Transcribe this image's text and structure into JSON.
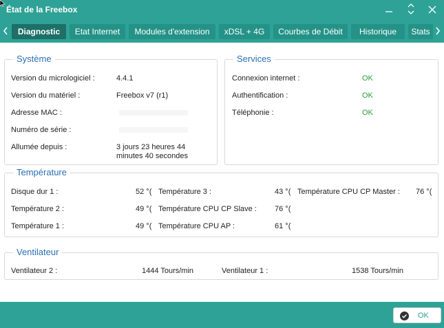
{
  "window": {
    "title": "État de la Freebox"
  },
  "tabs": [
    {
      "label": "Diagnostic"
    },
    {
      "label": "Etat Internet"
    },
    {
      "label": "Modules d'extension"
    },
    {
      "label": "xDSL + 4G"
    },
    {
      "label": "Courbes de Débit"
    },
    {
      "label": "Historique"
    },
    {
      "label": "Stats"
    }
  ],
  "systeme": {
    "legend": "Système",
    "rows": [
      {
        "label": "Version du micrologiciel :",
        "value": "4.4.1"
      },
      {
        "label": "Version du matériel :",
        "value": "Freebox v7 (r1)"
      },
      {
        "label": "Adresse MAC :",
        "value": ""
      },
      {
        "label": "Numéro de série :",
        "value": ""
      },
      {
        "label": "Allumée depuis :",
        "value_line1": "3 jours 23 heures 44",
        "value_line2": "minutes 40 secondes"
      }
    ]
  },
  "services": {
    "legend": "Services",
    "rows": [
      {
        "label": "Connexion internet :",
        "value": "OK"
      },
      {
        "label": "Authentification :",
        "value": "OK"
      },
      {
        "label": "Téléphonie :",
        "value": "OK"
      }
    ]
  },
  "temperature": {
    "legend": "Température",
    "rows": [
      {
        "l1": "Disque dur 1 :",
        "v1": "52 °(",
        "l2": "Température 3 :",
        "v2": "43 °(",
        "l3": "Température CPU CP Master :",
        "v3": "76 °("
      },
      {
        "l1": "Température 2 :",
        "v1": "49 °(",
        "l2": "Température CPU CP Slave :",
        "v2": "76 °("
      },
      {
        "l1": "Température 1 :",
        "v1": "49 °(",
        "l2": "Température CPU AP :",
        "v2": "61 °("
      }
    ]
  },
  "ventilateur": {
    "legend": "Ventilateur",
    "items": [
      {
        "label": "Ventilateur 2 :",
        "value": "1444 Tours/min"
      },
      {
        "label": "Ventilateur 1 :",
        "value": "1538 Tours/min"
      }
    ]
  },
  "footer": {
    "ok_label": "OK"
  }
}
